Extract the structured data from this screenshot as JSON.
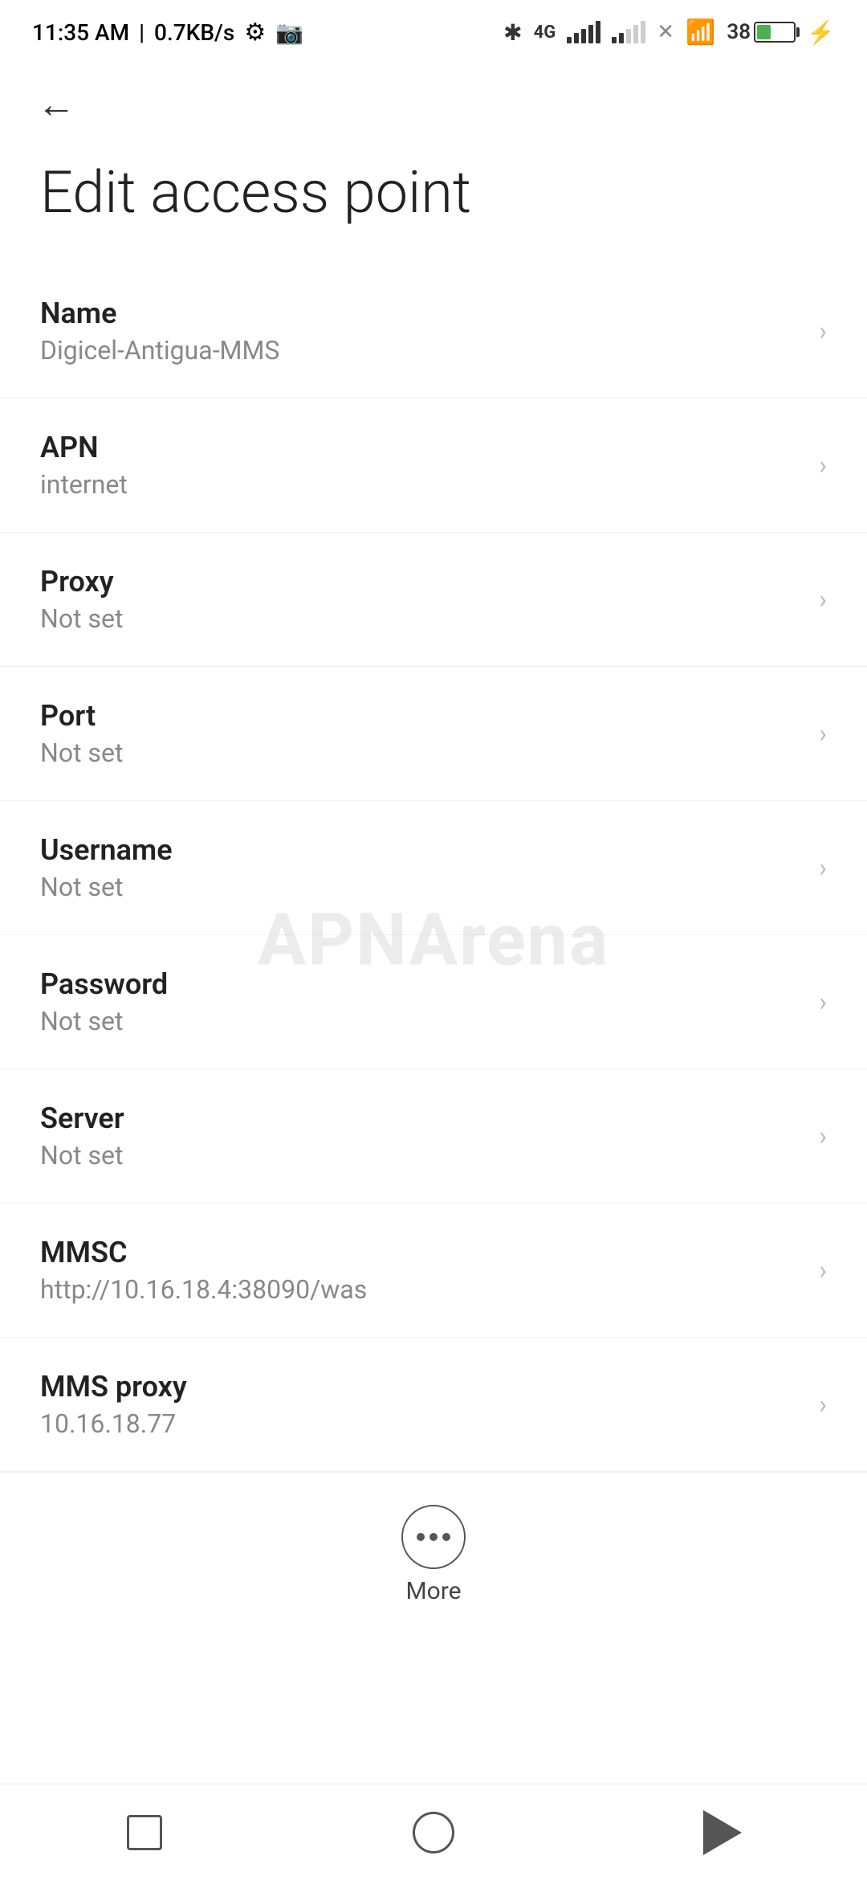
{
  "statusBar": {
    "time": "11:35 AM",
    "speed": "0.7KB/s"
  },
  "header": {
    "backLabel": "←",
    "title": "Edit access point"
  },
  "settings": [
    {
      "label": "Name",
      "value": "Digicel-Antigua-MMS"
    },
    {
      "label": "APN",
      "value": "internet"
    },
    {
      "label": "Proxy",
      "value": "Not set"
    },
    {
      "label": "Port",
      "value": "Not set"
    },
    {
      "label": "Username",
      "value": "Not set"
    },
    {
      "label": "Password",
      "value": "Not set"
    },
    {
      "label": "Server",
      "value": "Not set"
    },
    {
      "label": "MMSC",
      "value": "http://10.16.18.4:38090/was"
    },
    {
      "label": "MMS proxy",
      "value": "10.16.18.77"
    }
  ],
  "more": {
    "label": "More"
  },
  "bottomNav": {
    "square": "recent-apps",
    "circle": "home",
    "triangle": "back"
  },
  "watermark": {
    "text": "APNArena"
  }
}
